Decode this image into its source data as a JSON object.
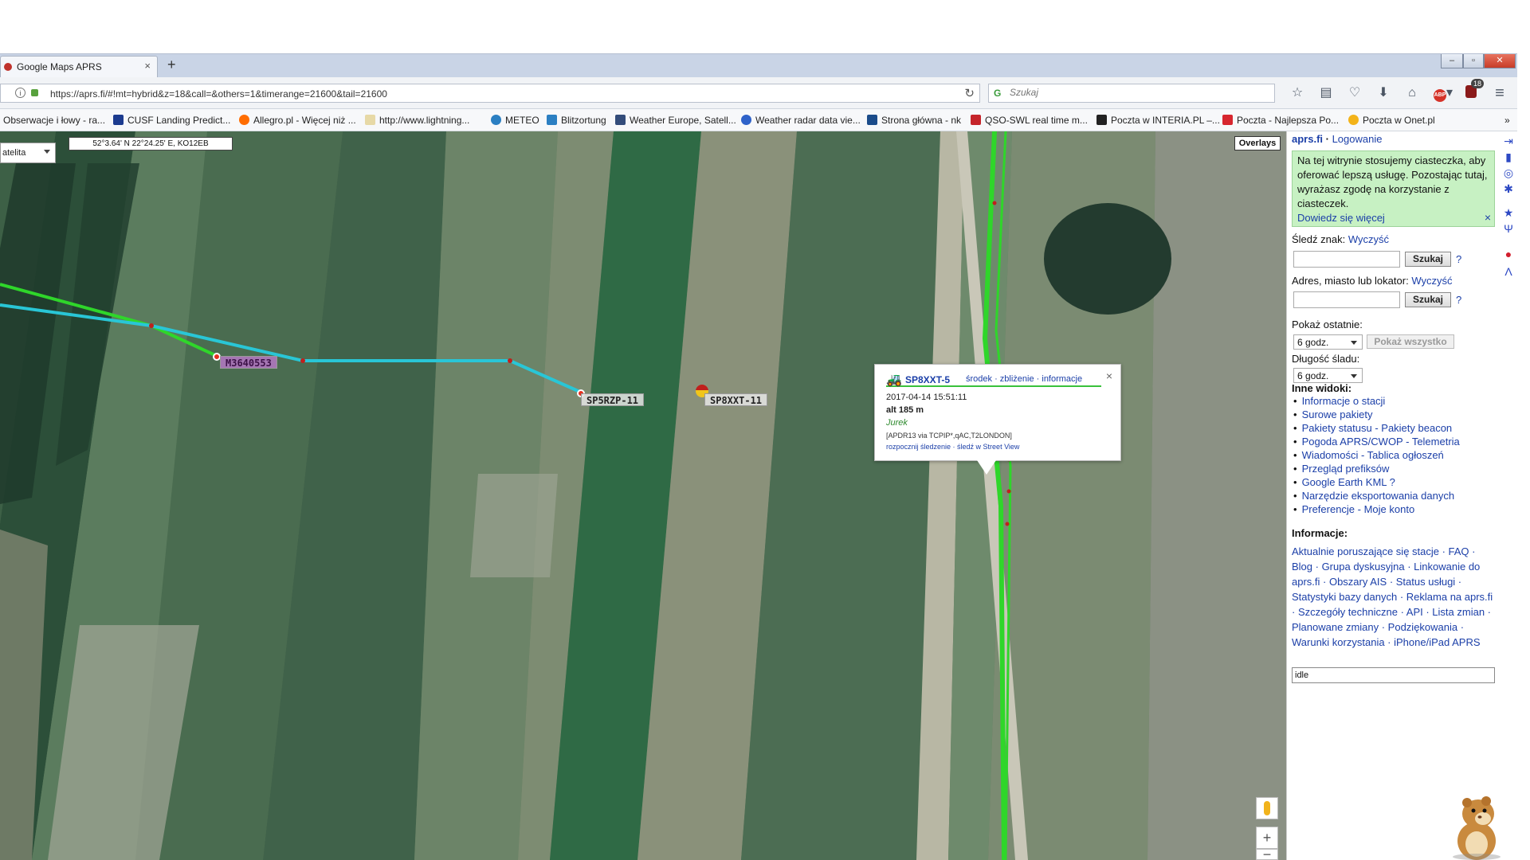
{
  "browser": {
    "tab_title": "Google Maps APRS",
    "tab_close": "×",
    "new_tab": "+",
    "url": "https://aprs.fi/#!mt=hybrid&z=18&call=&others=1&timerange=21600&tail=21600",
    "search_placeholder": "Szukaj",
    "window_buttons": [
      "–",
      "▫",
      "✕"
    ],
    "adblock_count": "18"
  },
  "bookmarks": [
    {
      "label": "Obserwacje i łowy - ra...",
      "icon": "globe-icon",
      "color": "#ffffff"
    },
    {
      "label": "CUSF Landing Predict...",
      "icon": "balloon-icon",
      "color": "#1c3b8f"
    },
    {
      "label": "Allegro.pl - Więcej niż ...",
      "icon": "allegro-icon",
      "color": "#ff6d00"
    },
    {
      "label": "http://www.lightning...",
      "icon": "page-icon",
      "color": "#e7d9a6"
    },
    {
      "label": "METEO",
      "icon": "meteo-icon",
      "color": "#2b7fc2"
    },
    {
      "label": "Blitzortung",
      "icon": "lightning-icon",
      "color": "#2b7fc2"
    },
    {
      "label": "Weather Europe, Satell...",
      "icon": "weather-icon",
      "color": "#334c7a"
    },
    {
      "label": "Weather radar data vie...",
      "icon": "radar-icon",
      "color": "#2e62c9"
    },
    {
      "label": "Strona główna - nk",
      "icon": "nk-icon",
      "color": "#1b4c8a"
    },
    {
      "label": "QSO-SWL real time m...",
      "icon": "qso-icon",
      "color": "#c5242a"
    },
    {
      "label": "Poczta w INTERIA.PL –...",
      "icon": "interia-icon",
      "color": "#222222"
    },
    {
      "label": "Poczta - Najlepsza Po...",
      "icon": "wp-icon",
      "color": "#d7262e"
    },
    {
      "label": "Poczta w Onet.pl",
      "icon": "onet-icon",
      "color": "#f3b319"
    }
  ],
  "map": {
    "maptype_label": "atelita",
    "coords": "52°3.64' N 22°24.25' E, KO12EB",
    "overlays_label": "Overlays",
    "stations": [
      {
        "call": "M3640553",
        "style": "purple"
      },
      {
        "call": "SP5RZP-11",
        "style": "plain"
      },
      {
        "call": "SP8XXT-11",
        "style": "plain"
      }
    ],
    "colors": {
      "track_green": "#2fd62a",
      "track_cyan": "#29c6d6",
      "field_dark": "#2f5a3a",
      "field_light": "#8f9a80"
    }
  },
  "popup": {
    "callsign": "SP8XXT-5",
    "links": "środek · zbliżenie · informacje",
    "close": "×",
    "time": "2017-04-14 15:51:11",
    "alt": "alt 185 m",
    "name": "Jurek",
    "path": "[APDR13 via TCPIP*,qAC,T2LONDON]",
    "track_links": "rozpocznij śledzenie · śledź w Street View"
  },
  "map_controls": {
    "zoom_in": "+",
    "zoom_out": "−"
  },
  "panel": {
    "title_site": "aprs.fi",
    "title_sep": " · ",
    "title_login": "Logowanie",
    "cookie_text": "Na tej witrynie stosujemy ciasteczka, aby oferować lepszą usługę. Pozostając tutaj, wyrażasz zgodę na korzystanie z ciasteczek.",
    "cookie_link": "Dowiedz się więcej",
    "cookie_close": "×",
    "track_label": "Śledź znak:",
    "track_clear": "Wyczyść",
    "search_btn": "Szukaj",
    "help": "?",
    "address_label": "Adres, miasto lub lokator:",
    "address_clear": "Wyczyść",
    "show_last_label": "Pokaż ostatnie:",
    "show_last_value": "6 godz.",
    "show_all": "Pokaż wszystko",
    "track_len_label": "Długość śladu:",
    "track_len_value": "6 godz.",
    "other_views_title": "Inne widoki:",
    "other_views": [
      "Informacje o stacji",
      "Surowe pakiety",
      "Pakiety statusu - Pakiety beacon",
      "Pogoda APRS/CWOP - Telemetria",
      "Wiadomości - Tablica ogłoszeń",
      "Przegląd prefiksów",
      "Google Earth KML ?",
      "Narzędzie eksportowania danych",
      "Preferencje - Moje konto"
    ],
    "info_title": "Informacje:",
    "info_links": "Aktualnie poruszające się stacje · FAQ · Blog · Grupa dyskusyjna · Linkowanie do aprs.fi · Obszary AIS · Status usługi · Statystyki bazy danych · Reklama na aprs.fi · Szczegóły techniczne · API · Lista zmian · Planowane zmiany · Podziękowania · Warunki korzystania · iPhone/iPad APRS",
    "idle_value": "idle"
  },
  "side_icons": [
    "login-arrow-icon",
    "tower-icon",
    "globe-icon",
    "person-icon",
    "star-icon",
    "antenna-icon",
    "balloon-icon",
    "aprs-a-icon"
  ]
}
